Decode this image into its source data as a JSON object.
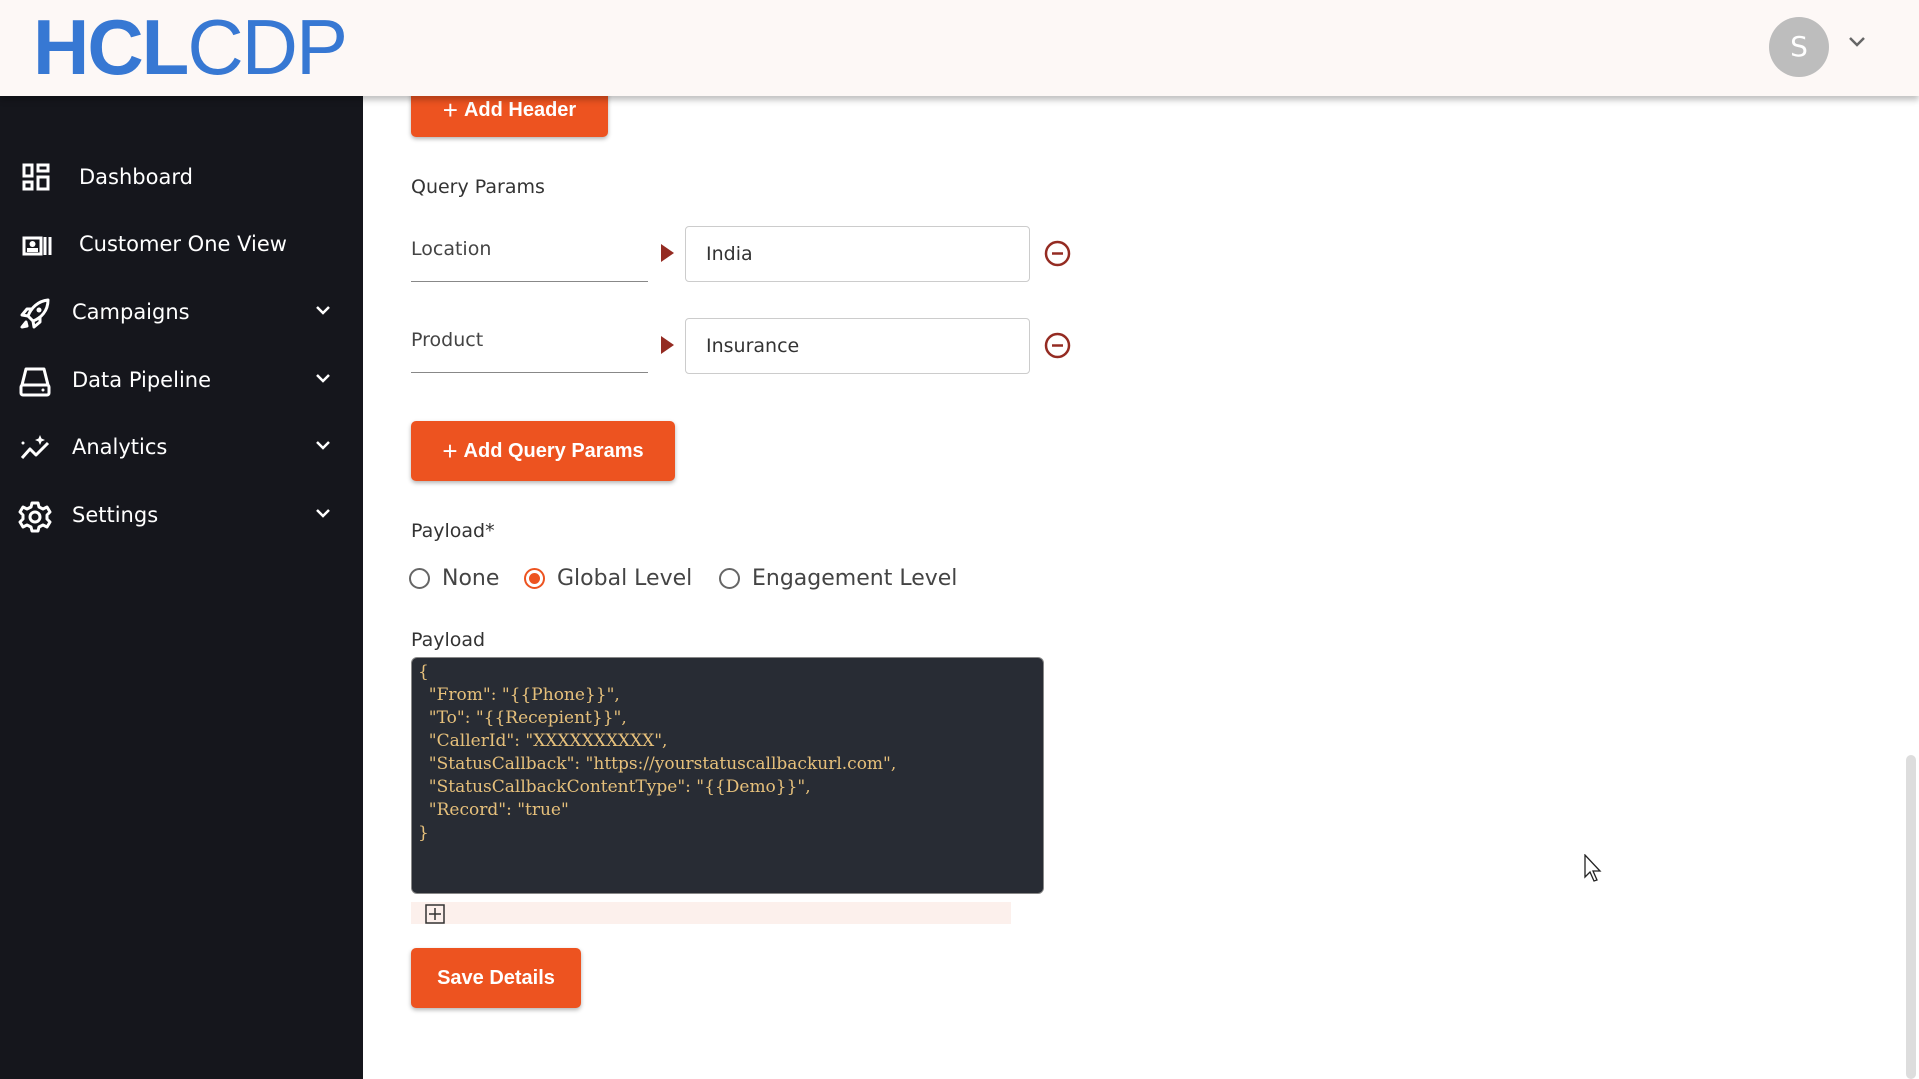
{
  "header": {
    "logo_bold": "HCL",
    "logo_light": "CDP",
    "avatar_initial": "S"
  },
  "sidebar": {
    "items": [
      {
        "label": "Dashboard",
        "icon": "dashboard-icon"
      },
      {
        "label": "Customer One View",
        "icon": "contact-card-icon"
      },
      {
        "label": "Campaigns",
        "icon": "rocket-icon",
        "expandable": true
      },
      {
        "label": "Data Pipeline",
        "icon": "storage-icon",
        "expandable": true
      },
      {
        "label": "Analytics",
        "icon": "analytics-icon",
        "expandable": true
      },
      {
        "label": "Settings",
        "icon": "gear-icon",
        "expandable": true
      }
    ]
  },
  "form": {
    "add_header_label": "Add Header",
    "query_params_title": "Query Params",
    "query_params": [
      {
        "key": "Location",
        "value": "India"
      },
      {
        "key": "Product",
        "value": "Insurance"
      }
    ],
    "add_query_params_label": "Add Query Params",
    "payload_type_label": "Payload*",
    "payload_options": [
      {
        "label": "None",
        "selected": false
      },
      {
        "label": "Global Level",
        "selected": true
      },
      {
        "label": "Engagement Level",
        "selected": false
      }
    ],
    "payload_label": "Payload",
    "payload_value": "{\n  \"From\": \"{{Phone}}\",\n  \"To\": \"{{Recepient}}\",\n  \"CallerId\": \"XXXXXXXXXX\",\n  \"StatusCallback\": \"https://yourstatuscallbackurl.com\",\n  \"StatusCallbackContentType\": \"{{Demo}}\",\n  \"Record\": \"true\"\n}",
    "save_label": "Save Details"
  },
  "colors": {
    "accent": "#ed5320",
    "logo": "#3778d3",
    "sidebar": "#15161c",
    "code_bg": "#282c34"
  }
}
